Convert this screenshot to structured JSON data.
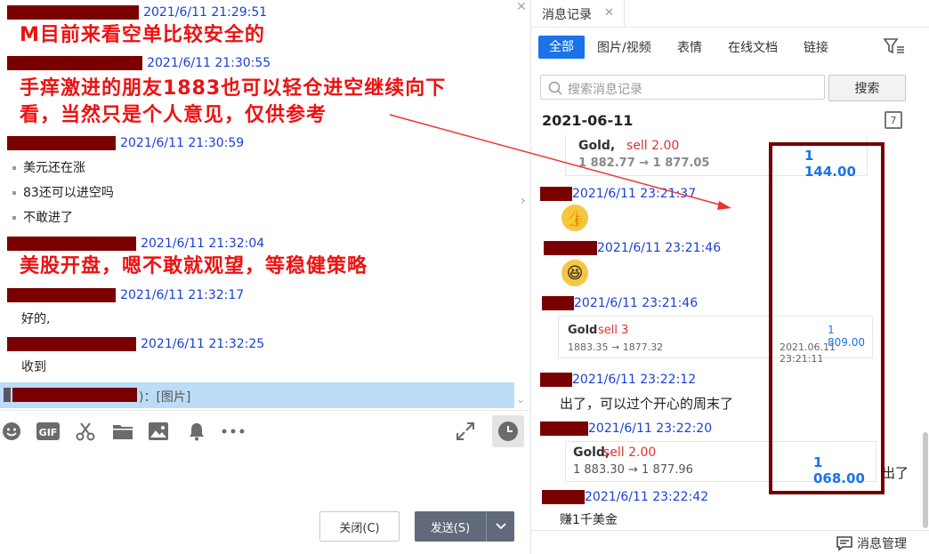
{
  "left_chat": {
    "messages": [
      {
        "time": "2021/6/11 21:29:51"
      },
      {
        "time": "2021/6/11 21:30:55"
      },
      {
        "time": "2021/6/11 21:30:59",
        "lines": [
          "美元还在涨",
          "83还可以进空吗",
          "不敢进了"
        ]
      },
      {
        "time": "2021/6/11 21:32:04"
      },
      {
        "time": "2021/6/11 21:32:17",
        "text": "好的,"
      },
      {
        "time": "2021/6/11 21:32:25",
        "text": "收到"
      }
    ],
    "annotations": [
      "M目前来看空单比较安全的",
      "手痒激进的朋友1883也可以轻仓进空继续向下",
      "看，当然只是个人意见，仅供参考",
      "美股开盘，嗯不敢就观望，等稳健策略"
    ],
    "selected_row_text": ")：[图片]",
    "close_icon": "close-icon",
    "toolbar": [
      "smile-icon",
      "gif-icon",
      "scissors-icon",
      "folder-icon",
      "image-icon",
      "bell-icon",
      "more-icon",
      "expand-icon",
      "history-clock-icon"
    ],
    "buttons": {
      "close": "关闭(C)",
      "send": "发送(S)"
    }
  },
  "history_panel": {
    "tab_title": "消息记录",
    "filters": [
      "全部",
      "图片/视频",
      "表情",
      "在线文档",
      "链接"
    ],
    "search_placeholder": "搜索消息记录",
    "search_button": "搜索",
    "date_header": "2021-06-11",
    "calendar_day": "7",
    "items": [
      {
        "card": {
          "symbol": "Gold,",
          "action": "sell 2.00",
          "prices": "1 882.77 → 1 877.05",
          "profit": "1 144.00"
        }
      },
      {
        "time": "2021/6/11 23:21:37",
        "emoji": "👍"
      },
      {
        "time": "2021/6/11 23:21:46",
        "emoji": "😆"
      },
      {
        "time": "2021/6/11 23:21:46",
        "card": {
          "symbol": "Gold",
          "action": "sell 3",
          "prices": "1883.35 → 1877.32",
          "profit": "1 809.00",
          "date": "2021.06.11 23:21:11"
        }
      },
      {
        "time": "2021/6/11 23:22:12",
        "text": "出了，可以过个开心的周末了"
      },
      {
        "time": "2021/6/11 23:22:20",
        "card": {
          "symbol": "Gold,",
          "action": "sell 2.00",
          "prices": "1 883.30 → 1 877.96",
          "profit": "1 068.00"
        },
        "overflow": "出了"
      },
      {
        "time": "2021/6/11 23:22:42",
        "text": "赚1千美金"
      }
    ],
    "manage_label": "消息管理"
  },
  "colors": {
    "accent": "#1a73e8",
    "redaction": "#7a0000",
    "annotation": "#ee1111",
    "timestamp": "#1a3fd6"
  }
}
